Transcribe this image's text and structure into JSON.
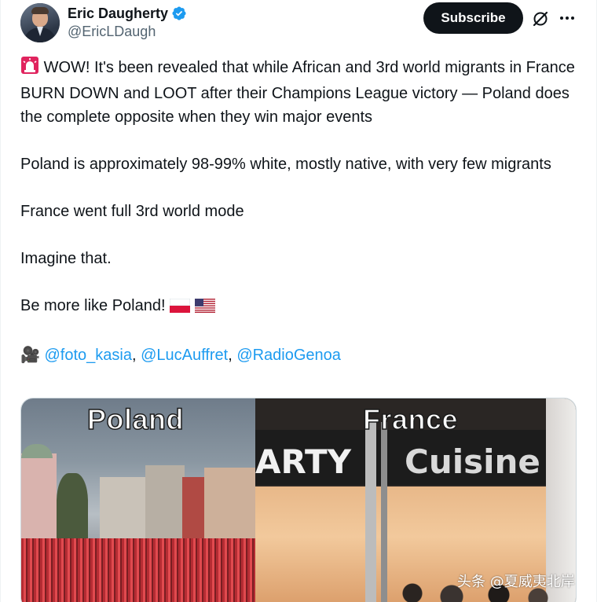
{
  "author": {
    "display_name": "Eric Daugherty",
    "handle": "@EricLDaugh",
    "verified_icon": "verified-badge-icon"
  },
  "actions": {
    "subscribe_label": "Subscribe",
    "grok_icon": "grok-icon",
    "more_icon": "more-icon"
  },
  "tweet": {
    "line1": "WOW! It's been revealed that while African and 3rd world migrants in France BURN DOWN and LOOT after their Champions League victory — Poland does the complete opposite when they win major events",
    "line2": "Poland is approximately 98-99% white, mostly native, with very few migrants",
    "line3": "France went full 3rd world mode",
    "line4": "Imagine that.",
    "line5": "Be more like Poland!",
    "credit_emoji": "🎥",
    "mentions": [
      "@foto_kasia",
      "@LucAuffret",
      "@RadioGenoa"
    ],
    "separator": ", "
  },
  "media": {
    "left_caption": "Poland",
    "right_caption": "France",
    "sign_left": "ARTY",
    "sign_right": "Cuisine"
  },
  "watermark": "头条 @夏威夷北岸",
  "colors": {
    "link": "#1d9bf0",
    "verified": "#1d9bf0",
    "siren": "#e0245e"
  }
}
